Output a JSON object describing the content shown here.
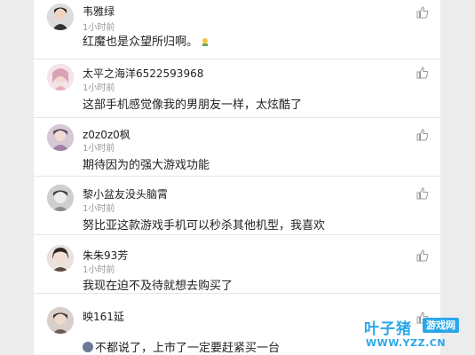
{
  "comments": [
    {
      "name": "韦雅绿",
      "time": "1小时前",
      "text": "红魔也是众望所归啊。",
      "avatar_color": "#3a3a3a"
    },
    {
      "name": "太平之海洋6522593968",
      "time": "1小时前",
      "text": "这部手机感觉像我的男朋友一样，太炫酷了",
      "avatar_color": "#e7b9c3"
    },
    {
      "name": "z0z0z0枫",
      "time": "1小时前",
      "text": "期待因为的强大游戏功能",
      "avatar_color": "#b9a2b8"
    },
    {
      "name": "黎小盆友没头脑霄",
      "time": "1小时前",
      "text": "努比亚这款游戏手机可以秒杀其他机型，我喜欢",
      "avatar_color": "#9a9a9a"
    },
    {
      "name": "朱朱93芳",
      "time": "1小时前",
      "text": "我现在迫不及待就想去购买了",
      "avatar_color": "#4b3a35"
    },
    {
      "name": "映161延",
      "time": "",
      "text": "不都说了，上市了一定要赶紧买一台",
      "avatar_color": "#6b5a52"
    }
  ],
  "watermark": {
    "brand": "叶子猪",
    "tag": "游戏网",
    "url": "WWW.YZZ.CN"
  },
  "icons": {
    "like": "thumbs-up-icon"
  }
}
